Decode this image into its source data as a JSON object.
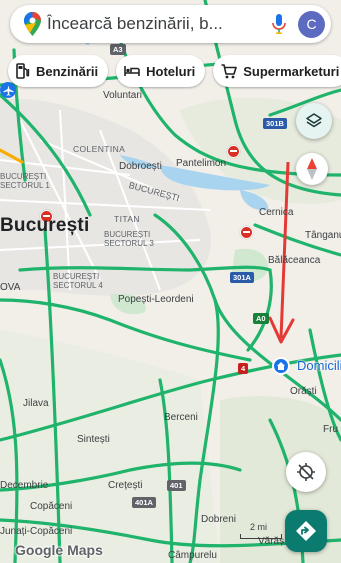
{
  "search": {
    "text": "Încearcă benzinării, b...",
    "avatar_letter": "C"
  },
  "chips": [
    {
      "label": "Benzinării",
      "icon": "gas-station-icon"
    },
    {
      "label": "Hoteluri",
      "icon": "bed-icon"
    },
    {
      "label": "Supermarketuri",
      "icon": "shopping-cart-icon"
    }
  ],
  "map": {
    "city": "București",
    "sectors": [
      "BUCUREȘTI\nSECTORUL 1",
      "BUCUREȘTI\nSECTORUL 3",
      "BUCUREȘTI\nSECTORUL 4"
    ],
    "places": {
      "voluntari": "Voluntari",
      "colentina": "COLENTINA",
      "dobroesti": "Dobroești",
      "pantelimon": "Pantelimon",
      "bucuresti_road": "BUCUREȘTI",
      "titan": "TITAN",
      "cernica": "Cernica",
      "tanganu": "Tânganu",
      "balaceanca": "Bălăceanca",
      "popesti": "Popești-Leordeni",
      "ova": "OVA",
      "orasti": "Orăști",
      "jilava": "Jilava",
      "berceni": "Berceni",
      "sintesti": "Sintești",
      "fru": "Fru",
      "decembrie": "Decembrie",
      "copaceni": "Copăceni",
      "crestti": "Crețești",
      "dobreni": "Dobreni",
      "unati": "Junați-Copăceni",
      "varas": "Vărăș",
      "campurelu": "Câmpurelu"
    },
    "shields": {
      "a3": "A3",
      "r301b": "301B",
      "r301a": "301A",
      "a0": "A0",
      "r4": "4",
      "r401": "401",
      "r401a": "401A"
    },
    "destination": "Domicili",
    "scale": "2 mi",
    "logo": "Google Maps"
  },
  "colors": {
    "road_green": "#1fb36b",
    "route_red": "#e53935",
    "accent_blue": "#1a73e8",
    "avatar_purple": "#5c6bc0"
  }
}
